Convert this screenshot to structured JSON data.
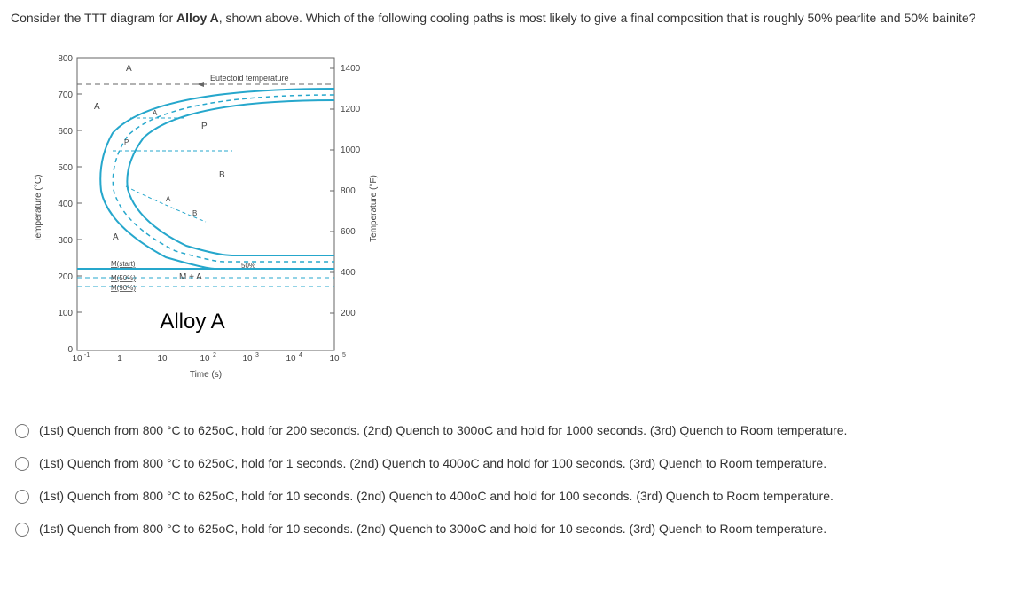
{
  "question": {
    "prefix": "Consider the TTT diagram for ",
    "alloy": "Alloy A",
    "middle": ", shown above.  Which of the following cooling paths is most likely to give a final composition that is roughly 50% pearlite and 50% bainite?"
  },
  "figure": {
    "left_axis_label": "Temperature (°C)",
    "right_axis_label": "Temperature (°F)",
    "x_axis_label": "Time (s)",
    "alloy_label": "Alloy A",
    "eutectoid_label": "Eutectoid temperature",
    "region_A_top": "A",
    "region_A_left": "A",
    "region_A_bottom": "A",
    "region_P": "P",
    "region_B": "B",
    "region_MA": "M + A",
    "m_start": "M(start)",
    "m_50": "M(50%)",
    "m_90": "M(90%)",
    "fifty_pct": "50%",
    "dash_A": "A",
    "dash_B": "B",
    "left_ticks": [
      "800",
      "700",
      "600",
      "500",
      "400",
      "300",
      "200",
      "100",
      "0"
    ],
    "right_ticks": [
      "1400",
      "1200",
      "1000",
      "800",
      "600",
      "400",
      "200"
    ],
    "x_ticks": [
      "10",
      "1",
      "10",
      "10",
      "10",
      "10",
      "10"
    ],
    "x_exps": [
      "-1",
      "",
      "",
      "2",
      "3",
      "4",
      "5"
    ]
  },
  "options": [
    "(1st) Quench from 800 °C to 625oC, hold for 200 seconds. (2nd) Quench to 300oC and hold for 1000 seconds. (3rd) Quench to Room temperature.",
    "(1st) Quench from 800 °C to 625oC, hold for 1 seconds. (2nd) Quench to 400oC and hold for 100 seconds. (3rd) Quench to Room temperature.",
    "(1st) Quench from 800 °C to 625oC, hold for 10 seconds. (2nd) Quench to 400oC and hold for 100 seconds. (3rd) Quench to Room temperature.",
    "(1st) Quench from 800 °C to 625oC, hold for 10 seconds. (2nd) Quench to 300oC and hold for 10 seconds. (3rd) Quench to Room temperature."
  ],
  "chart_data": {
    "type": "TTT-diagram",
    "x_axis": {
      "label": "Time (s)",
      "scale": "log",
      "range": [
        0.1,
        100000
      ]
    },
    "y_axis_left": {
      "label": "Temperature (°C)",
      "range": [
        0,
        800
      ]
    },
    "y_axis_right": {
      "label": "Temperature (°F)",
      "range": [
        0,
        1500
      ]
    },
    "eutectoid_temperature_C": 727,
    "martensite_lines_C": {
      "start": 215,
      "50%": 190,
      "90%": 170
    },
    "regions": [
      "A (austenite)",
      "P (pearlite)",
      "B (bainite)",
      "M+A (martensite + austenite)"
    ],
    "nose_approx": {
      "time_s": 1,
      "temperature_C": 540
    }
  }
}
